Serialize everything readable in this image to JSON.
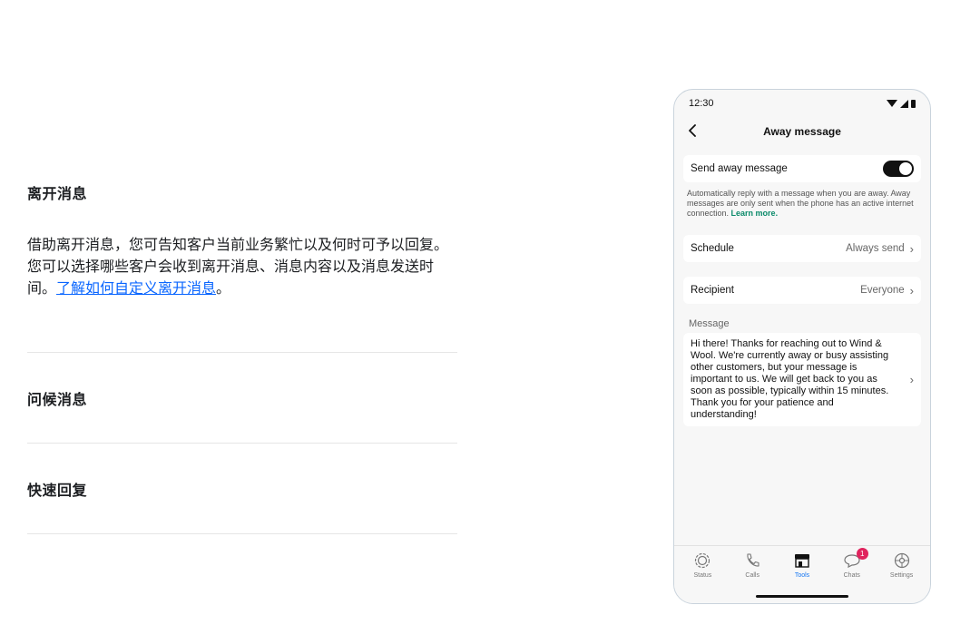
{
  "accordion": {
    "sections": [
      {
        "title": "离开消息",
        "body_text": "借助离开消息，您可告知客户当前业务繁忙以及何时可予以回复。您可以选择哪些客户会收到离开消息、消息内容以及消息发送时间。",
        "link_text": "了解如何自定义离开消息",
        "after_link": "。"
      },
      {
        "title": "问候消息"
      },
      {
        "title": "快速回复"
      }
    ]
  },
  "phone": {
    "status_bar": {
      "time": "12:30"
    },
    "app_bar": {
      "title": "Away message"
    },
    "toggle": {
      "label": "Send away message",
      "on": true
    },
    "helper": {
      "text": "Automatically reply with a message when you are away. Away messages are only sent when the phone has an active internet connection. ",
      "link": "Learn more."
    },
    "schedule": {
      "label": "Schedule",
      "value": "Always send"
    },
    "recipient": {
      "label": "Recipient",
      "value": "Everyone"
    },
    "message": {
      "section_label": "Message",
      "text": "Hi there! Thanks for reaching out to Wind & Wool. We're currently away or busy assisting other customers, but your message is important to us. We will get back to you as soon as possible, typically within 15 minutes. Thank you for your patience and understanding!"
    },
    "bottom_nav": {
      "items": [
        {
          "label": "Status",
          "icon": "status-icon"
        },
        {
          "label": "Calls",
          "icon": "phone-icon"
        },
        {
          "label": "Tools",
          "icon": "store-icon",
          "active": true
        },
        {
          "label": "Chats",
          "icon": "chat-icon",
          "badge": "1"
        },
        {
          "label": "Settings",
          "icon": "gear-icon"
        }
      ]
    },
    "colors": {
      "accent": "#1877f2",
      "link": "#0a8a6a",
      "badge": "#e0245e"
    }
  }
}
